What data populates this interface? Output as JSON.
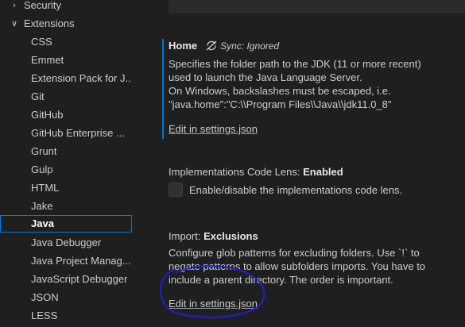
{
  "sidebar": {
    "items": [
      {
        "label": "Security",
        "chevron": "chevron-right",
        "expanded": false
      },
      {
        "label": "Extensions",
        "chevron": "chevron-down",
        "expanded": true
      }
    ],
    "children": [
      {
        "label": "CSS"
      },
      {
        "label": "Emmet"
      },
      {
        "label": "Extension Pack for J..."
      },
      {
        "label": "Git"
      },
      {
        "label": "GitHub"
      },
      {
        "label": "GitHub Enterprise ..."
      },
      {
        "label": "Grunt"
      },
      {
        "label": "Gulp"
      },
      {
        "label": "HTML"
      },
      {
        "label": "Jake"
      },
      {
        "label": "Java",
        "selected": true
      },
      {
        "label": "Java Debugger"
      },
      {
        "label": "Java Project Manag..."
      },
      {
        "label": "JavaScript Debugger"
      },
      {
        "label": "JSON"
      },
      {
        "label": "LESS"
      }
    ]
  },
  "settings": {
    "home": {
      "title": "Home",
      "sync_status": "Sync: Ignored",
      "desc_lines": [
        "Specifies the folder path to the JDK (11 or more recent)",
        "used to launch the Java Language Server.",
        "On Windows, backslashes must be escaped, i.e.",
        "\"java.home\":\"C:\\\\Program Files\\\\Java\\\\jdk11.0_8\""
      ],
      "link": "Edit in settings.json"
    },
    "implementations": {
      "category": "Implementations Code Lens: ",
      "name": "Enabled",
      "checkbox_label": "Enable/disable the implementations code lens.",
      "checked": false
    },
    "import": {
      "category": "Import: ",
      "name": "Exclusions",
      "desc_lines": [
        "Configure glob patterns for excluding folders. Use `!` to",
        "negate patterns to allow subfolders imports. You have to",
        "include a parent directory. The order is important."
      ],
      "link": "Edit in settings.json"
    }
  },
  "colors": {
    "accent": "#0078d4",
    "annotation": "#1f1fd6"
  }
}
